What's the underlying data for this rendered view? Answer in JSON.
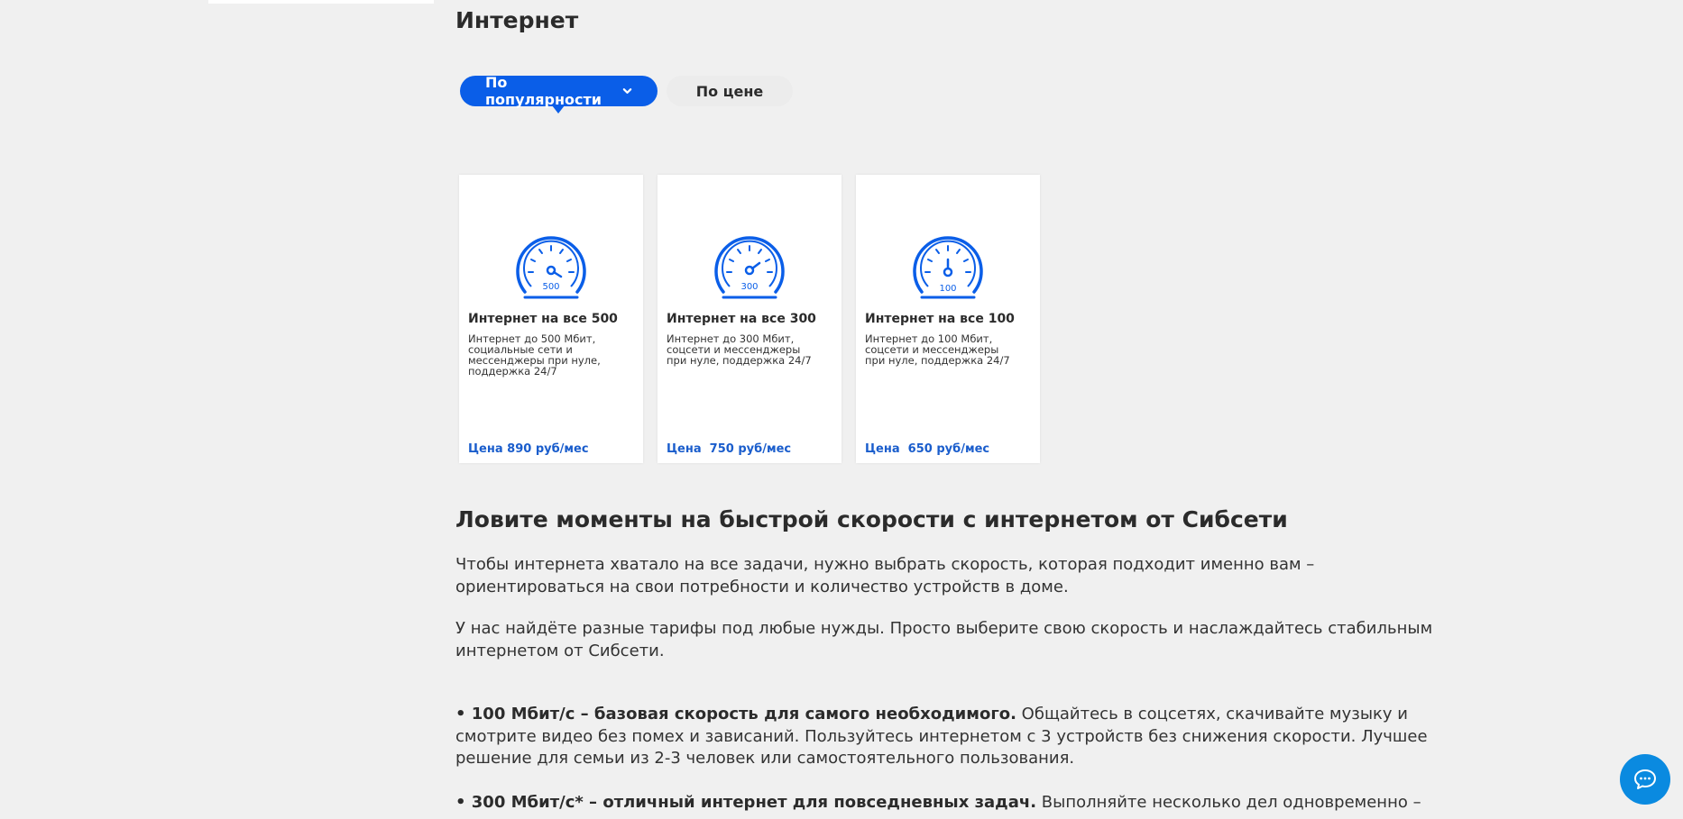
{
  "page": {
    "title": "Интернет"
  },
  "sort": {
    "popularity_label": "По популярности",
    "price_label": "По цене"
  },
  "tariffs": [
    {
      "speed_label": "500",
      "title": "Интернет на все 500",
      "description": "Интернет до 500 Мбит, социальные сети и мессенджеры при нуле, поддержка 24/7",
      "price": "Цена 890 руб/мес"
    },
    {
      "speed_label": "300",
      "title": "Интернет на все 300",
      "description": "Интернет до 300 Мбит, соцсети и мессенджеры при нуле, поддержка 24/7",
      "price": "Цена  750 руб/мес"
    },
    {
      "speed_label": "100",
      "title": "Интернет на все 100",
      "description": "Интернет до 100 Мбит, соцсети и мессенджеры при нуле, поддержка 24/7",
      "price": "Цена  650 руб/мес"
    }
  ],
  "article": {
    "heading": "Ловите моменты на быстрой скорости с интернетом от Сибсети",
    "p1": "Чтобы интернета хватало на все задачи, нужно выбрать скорость, которая подходит именно вам – ориентироваться на свои потребности и количество устройств в доме.",
    "p2": "У нас найдёте разные тарифы под любые нужды. Просто выберите свою скорость и наслаждайтесь стабильным интернетом от Сибсети.",
    "bullet1_bold": "• 100 Мбит/с – базовая скорость для самого необходимого.",
    "bullet1_text": " Общайтесь в соцсетях, скачивайте музыку и смотрите видео без помех и зависаний. Пользуйтесь интернетом с 3 устройств без снижения скорости. Лучшее решение для семьи из 2-3 человек или самостоятельного пользования.",
    "bullet2_bold": "• 300 Мбит/с* – отличный интернет для повседневных задач.",
    "bullet2_text": " Выполняйте несколько дел одновременно –"
  },
  "icons": {
    "gauge": "speedometer-icon",
    "chat": "chat-bubble-icon",
    "chevron": "chevron-down-icon"
  },
  "colors": {
    "accent": "#0a5ee8",
    "price": "#1a5dcc",
    "chat": "#0a8ae0",
    "background": "#f0f0f0"
  }
}
